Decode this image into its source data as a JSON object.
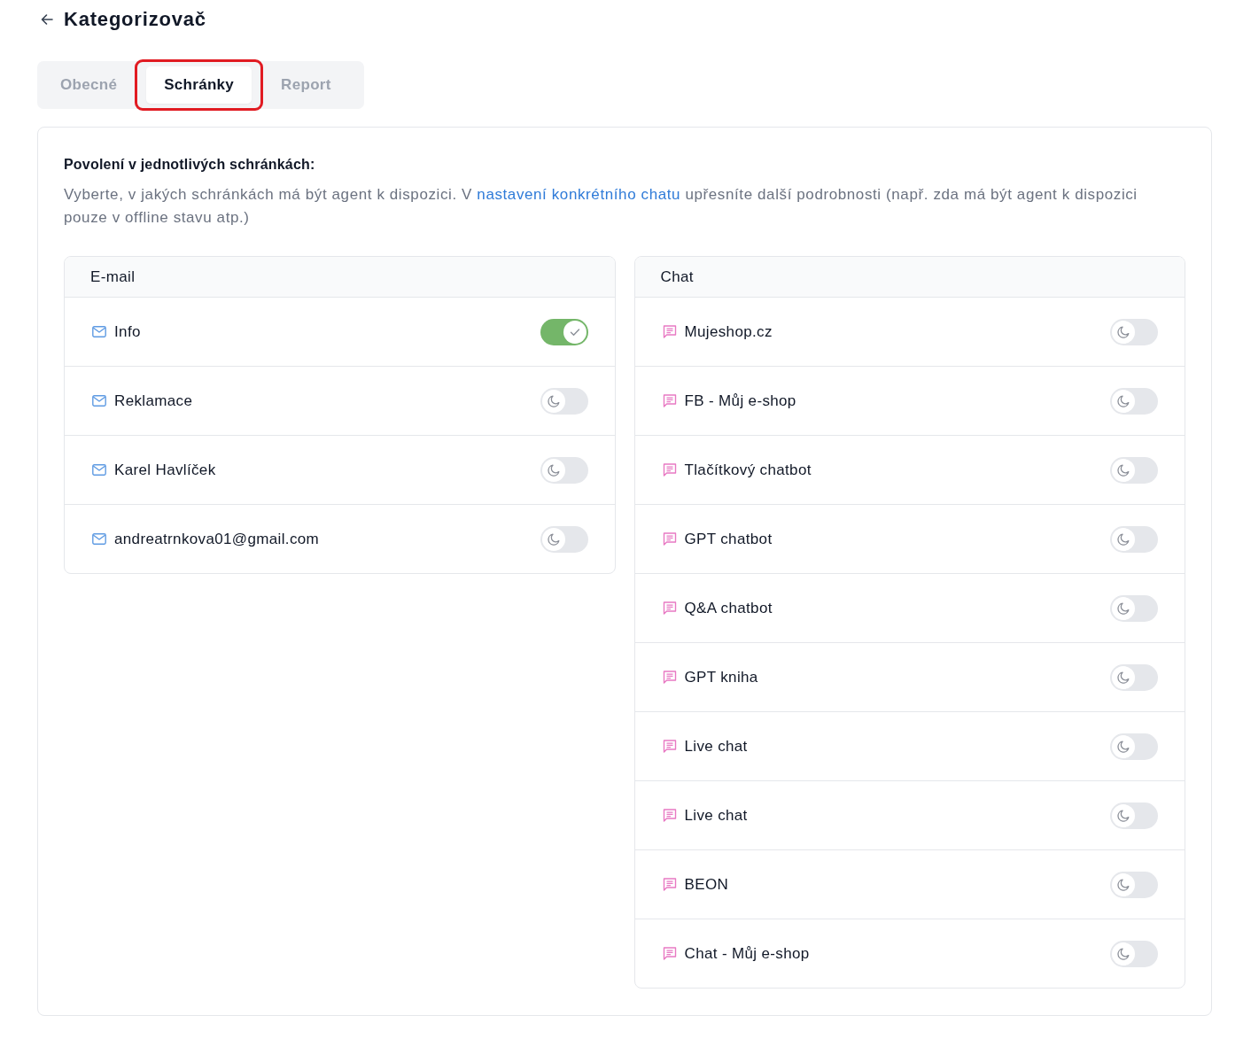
{
  "header": {
    "title": "Kategorizovač"
  },
  "tabs": [
    {
      "label": "Obecné",
      "selected": false,
      "highlighted": false
    },
    {
      "label": "Schránky",
      "selected": true,
      "highlighted": true
    },
    {
      "label": "Report",
      "selected": false,
      "highlighted": false
    }
  ],
  "section": {
    "title": "Povolení v jednotlivých schránkách:",
    "description_before": "Vyberte, v jakých schránkách má být agent k dispozici. V ",
    "link": "nastavení konkrétního chatu",
    "description_after": " upřesníte další podrobnosti (např. zda má být agent k dispozici pouze v offline stavu atp.)"
  },
  "panels": [
    {
      "kind": "email",
      "title": "E-mail",
      "items": [
        {
          "name": "Info",
          "enabled": true
        },
        {
          "name": "Reklamace",
          "enabled": false
        },
        {
          "name": "Karel Havlíček",
          "enabled": false
        },
        {
          "name": "andreatrnkova01@gmail.com",
          "enabled": false
        }
      ]
    },
    {
      "kind": "chat",
      "title": "Chat",
      "items": [
        {
          "name": "Mujeshop.cz",
          "enabled": false
        },
        {
          "name": "FB - Můj e-shop",
          "enabled": false
        },
        {
          "name": "Tlačítkový chatbot",
          "enabled": false
        },
        {
          "name": "GPT chatbot",
          "enabled": false
        },
        {
          "name": "Q&A chatbot",
          "enabled": false
        },
        {
          "name": "GPT kniha",
          "enabled": false
        },
        {
          "name": "Live chat",
          "enabled": false
        },
        {
          "name": "Live chat",
          "enabled": false
        },
        {
          "name": "BEON",
          "enabled": false
        },
        {
          "name": "Chat - Můj e-shop",
          "enabled": false
        }
      ]
    }
  ]
}
